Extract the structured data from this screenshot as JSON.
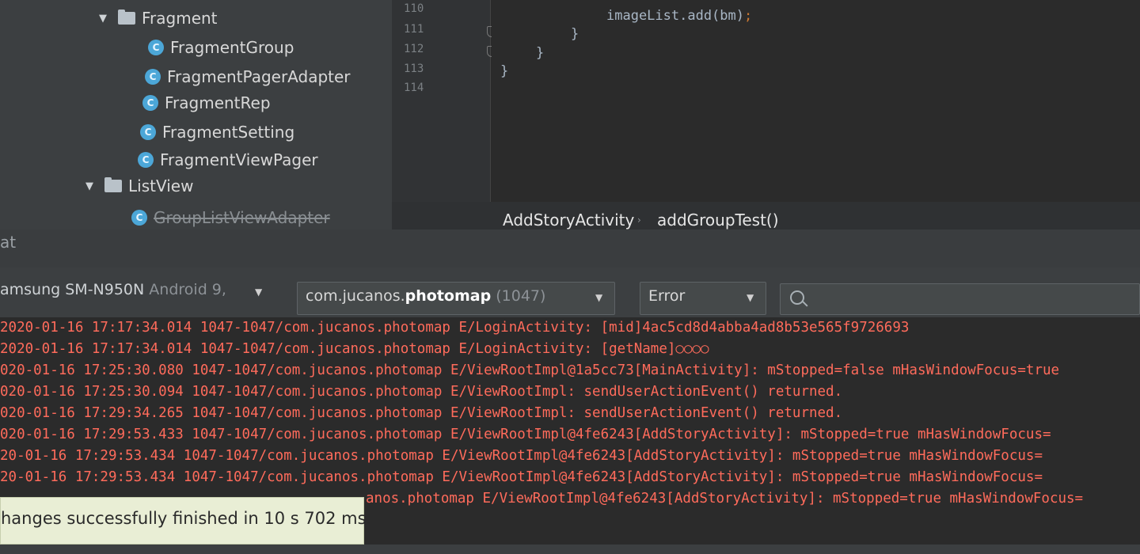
{
  "project_tree": {
    "folder_fragment": "Fragment",
    "fragment_children": [
      "FragmentGroup",
      "FragmentPagerAdapter",
      "FragmentRep",
      "FragmentSetting",
      "FragmentViewPager"
    ],
    "folder_listview": "ListView",
    "listview_children": [
      "GroupListViewAdapter"
    ]
  },
  "editor": {
    "line_numbers": [
      "110",
      "111",
      "112",
      "113",
      "114"
    ],
    "code_lines": [
      "imageList.add(bm)",
      "}",
      "}",
      "}"
    ],
    "semicolon": ";"
  },
  "breadcrumb": {
    "class_name": "AddStoryActivity",
    "method_name": "addGroupTest()"
  },
  "logcat": {
    "title": "at",
    "device": {
      "model": "amsung SM-N950N",
      "os": "Android 9,"
    },
    "process": {
      "prefix": "com.jucanos.",
      "name": "photomap",
      "pid": "(1047)"
    },
    "level": "Error",
    "search_placeholder": ""
  },
  "log_lines": [
    "2020-01-16 17:17:34.014 1047-1047/com.jucanos.photomap E/LoginActivity: [mid]4ac5cd8d4abba4ad8b53e565f9726693",
    "2020-01-16 17:17:34.014 1047-1047/com.jucanos.photomap E/LoginActivity: [getName]○○○○",
    "020-01-16 17:25:30.080 1047-1047/com.jucanos.photomap E/ViewRootImpl@1a5cc73[MainActivity]: mStopped=false mHasWindowFocus=true",
    "020-01-16 17:25:30.094 1047-1047/com.jucanos.photomap E/ViewRootImpl: sendUserActionEvent() returned.",
    "020-01-16 17:29:34.265 1047-1047/com.jucanos.photomap E/ViewRootImpl: sendUserActionEvent() returned.",
    "020-01-16 17:29:53.433 1047-1047/com.jucanos.photomap E/ViewRootImpl@4fe6243[AddStoryActivity]: mStopped=true mHasWindowFocus=",
    "20-01-16 17:29:53.434 1047-1047/com.jucanos.photomap E/ViewRootImpl@4fe6243[AddStoryActivity]: mStopped=true mHasWindowFocus=",
    "20-01-16 17:29:53.434 1047-1047/com.jucanos.photomap E/ViewRootImpl@4fe6243[AddStoryActivity]: mStopped=true mHasWindowFocus=",
    "anos.photomap E/ViewRootImpl@4fe6243[AddStoryActivity]: mStopped=true mHasWindowFocus="
  ],
  "toast": {
    "message": "hanges successfully finished in 10 s 702 ms."
  },
  "icons": {
    "class": "class-icon",
    "folder": "folder-icon",
    "search": "search-icon"
  },
  "colors": {
    "error_text": "#ff6b5b",
    "class_icon": "#4ca7d8",
    "toast_bg": "#e9eed5"
  }
}
